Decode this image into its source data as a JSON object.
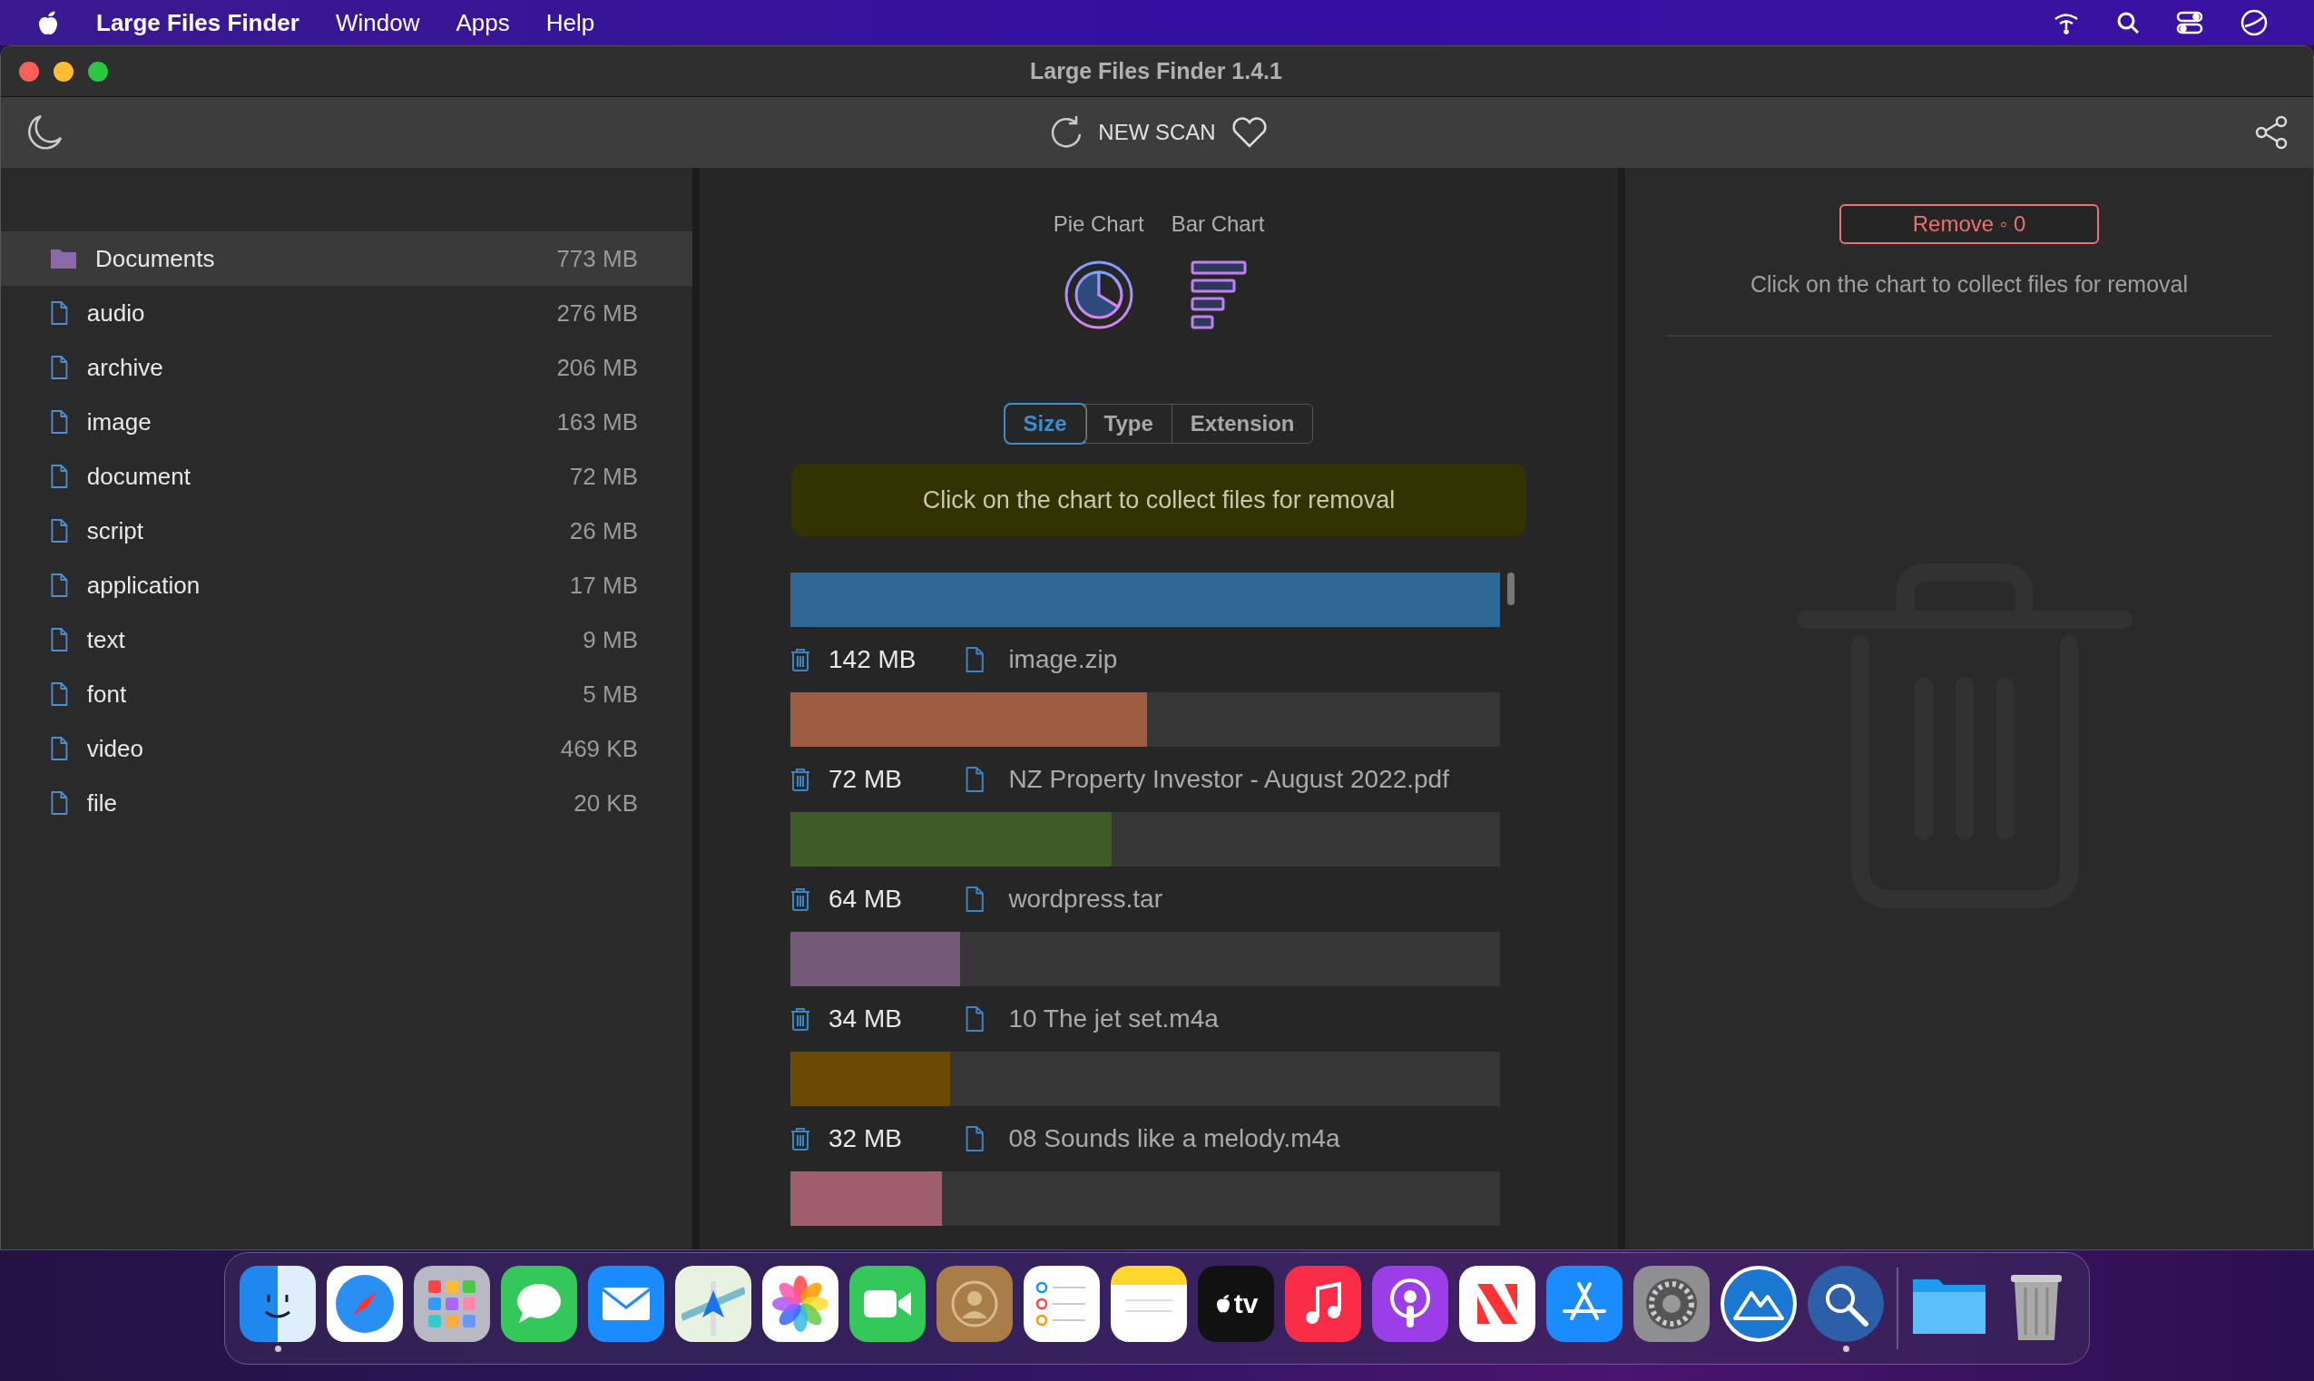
{
  "menu_bar": {
    "app_name": "Large Files Finder",
    "items": [
      "Window",
      "Apps",
      "Help"
    ]
  },
  "window": {
    "title": "Large Files Finder 1.4.1"
  },
  "toolbar": {
    "new_scan": "NEW SCAN"
  },
  "sidebar": {
    "items": [
      {
        "kind": "folder",
        "name": "Documents",
        "size": "773 MB",
        "selected": true
      },
      {
        "kind": "file",
        "name": "audio",
        "size": "276 MB",
        "selected": false
      },
      {
        "kind": "file",
        "name": "archive",
        "size": "206 MB",
        "selected": false
      },
      {
        "kind": "file",
        "name": "image",
        "size": "163 MB",
        "selected": false
      },
      {
        "kind": "file",
        "name": "document",
        "size": "72 MB",
        "selected": false
      },
      {
        "kind": "file",
        "name": "script",
        "size": "26 MB",
        "selected": false
      },
      {
        "kind": "file",
        "name": "application",
        "size": "17 MB",
        "selected": false
      },
      {
        "kind": "file",
        "name": "text",
        "size": "9 MB",
        "selected": false
      },
      {
        "kind": "file",
        "name": "font",
        "size": "5 MB",
        "selected": false
      },
      {
        "kind": "file",
        "name": "video",
        "size": "469 KB",
        "selected": false
      },
      {
        "kind": "file",
        "name": "file",
        "size": "20 KB",
        "selected": false
      }
    ]
  },
  "chart_types": [
    {
      "kind": "pie",
      "label": "Pie Chart"
    },
    {
      "kind": "bar",
      "label": "Bar Chart"
    }
  ],
  "tabs": [
    {
      "label": "Size",
      "selected": true
    },
    {
      "label": "Type",
      "selected": false
    },
    {
      "label": "Extension",
      "selected": false
    }
  ],
  "banner": "Click on the chart to collect files for removal",
  "files": [
    {
      "size": "142 MB",
      "name": "image.zip",
      "level": 1.0,
      "color": "#2d6896"
    },
    {
      "size": "72 MB",
      "name": "NZ Property Investor - August 2022.pdf",
      "level": 0.503,
      "color": "#9e5d42"
    },
    {
      "size": "64 MB",
      "name": "wordpress.tar",
      "level": 0.453,
      "color": "#3e5c27"
    },
    {
      "size": "34 MB",
      "name": "10 The jet set.m4a",
      "level": 0.239,
      "color": "#735a76"
    },
    {
      "size": "32 MB",
      "name": "08 Sounds like a melody.m4a",
      "level": 0.225,
      "color": "#6b4a04"
    },
    {
      "level": 0.214,
      "color": "#a05d6c"
    }
  ],
  "removal": {
    "button": "Remove ◦ 0",
    "hint": "Click on the chart to collect files for removal"
  },
  "dock": [
    {
      "kind": "finder",
      "running": true
    },
    {
      "kind": "compass",
      "running": false
    },
    {
      "kind": "grid",
      "running": false
    },
    {
      "kind": "chat",
      "running": false
    },
    {
      "kind": "mail",
      "running": false
    },
    {
      "kind": "map",
      "running": false
    },
    {
      "kind": "flower",
      "running": false
    },
    {
      "kind": "camera",
      "running": false
    },
    {
      "kind": "contacts",
      "running": false
    },
    {
      "kind": "list",
      "running": false
    },
    {
      "kind": "notes",
      "running": false
    },
    {
      "kind": "tv",
      "label": "tv",
      "running": false
    },
    {
      "kind": "music",
      "running": false
    },
    {
      "kind": "podcast",
      "running": false
    },
    {
      "kind": "news",
      "running": false
    },
    {
      "kind": "store",
      "running": false
    },
    {
      "kind": "gear",
      "running": false
    },
    {
      "kind": "mountain",
      "running": false
    },
    {
      "kind": "search",
      "running": true
    },
    {
      "kind": "divider"
    },
    {
      "kind": "folder",
      "running": false
    },
    {
      "kind": "trash",
      "running": false
    }
  ]
}
